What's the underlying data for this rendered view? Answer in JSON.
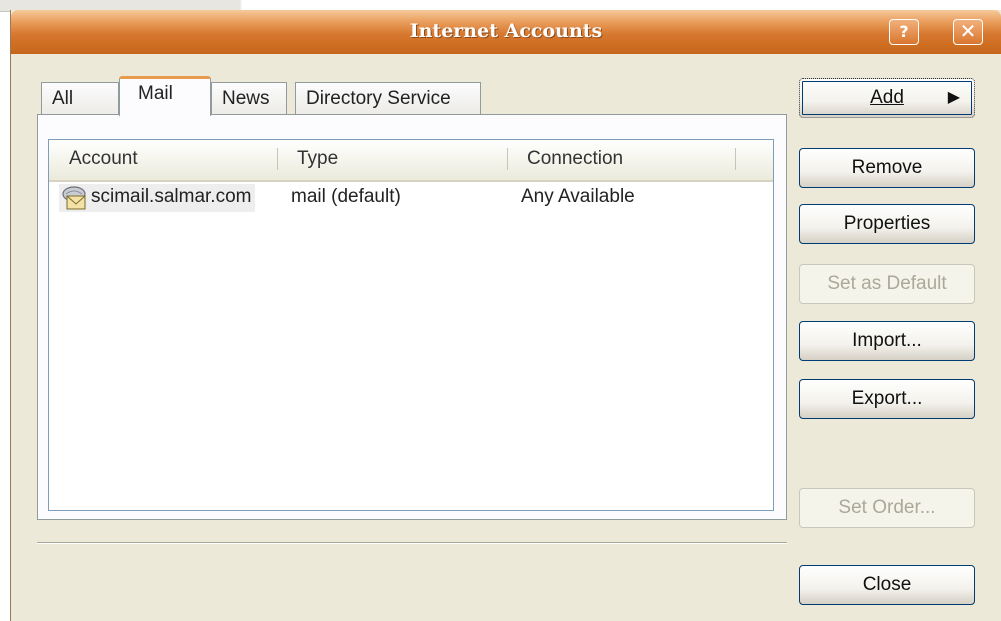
{
  "window": {
    "title": "Internet Accounts",
    "help_label": "?",
    "close_label": "✕"
  },
  "tabs": [
    {
      "label": "All"
    },
    {
      "label": "Mail",
      "selected": true
    },
    {
      "label": "News"
    },
    {
      "label": "Directory Service"
    }
  ],
  "list": {
    "columns": [
      "Account",
      "Type",
      "Connection"
    ],
    "rows": [
      {
        "account": "scimail.salmar.com",
        "type": "mail (default)",
        "connection": "Any Available",
        "icon": "mail-account-icon"
      }
    ]
  },
  "buttons": {
    "add": "Add",
    "remove": "Remove",
    "properties": "Properties",
    "set_default": "Set as Default",
    "import": "Import...",
    "export": "Export...",
    "set_order": "Set Order...",
    "close": "Close"
  },
  "colors": {
    "title_bar": "#d6782f",
    "dialog_bg": "#ece9d8",
    "selected_tab_accent": "#e69b4d"
  }
}
